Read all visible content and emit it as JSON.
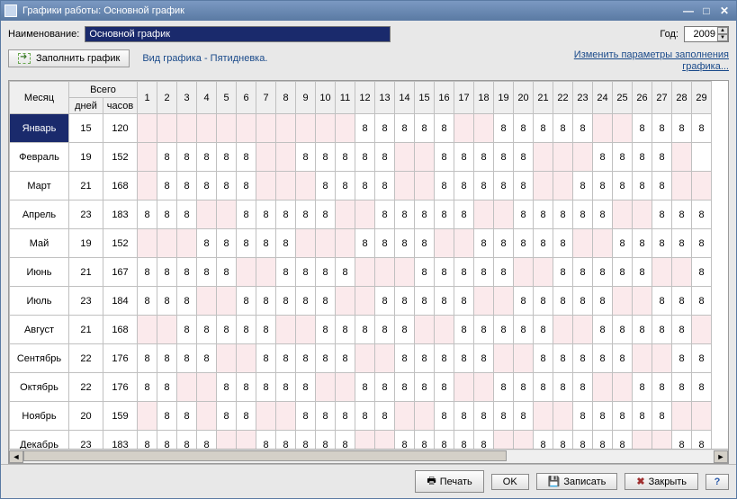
{
  "window": {
    "title": "Графики работы: Основной график"
  },
  "toolbar": {
    "name_label": "Наименование:",
    "name_value": "Основной график",
    "year_label": "Год:",
    "year_value": "2009",
    "fill_button": "Заполнить график",
    "schedule_type": "Вид графика - Пятидневка.",
    "change_params_link": "Изменить параметры заполнения графика..."
  },
  "grid": {
    "headers": {
      "month": "Месяц",
      "total": "Всего",
      "days": "дней",
      "hours": "часов"
    },
    "day_numbers": [
      1,
      2,
      3,
      4,
      5,
      6,
      7,
      8,
      9,
      10,
      11,
      12,
      13,
      14,
      15,
      16,
      17,
      18,
      19,
      20,
      21,
      22,
      23,
      24,
      25,
      26,
      27,
      28,
      29
    ],
    "months": [
      {
        "name": "Январь",
        "days": 15,
        "hours": 120,
        "weekend": [
          1,
          2,
          3,
          4,
          5,
          6,
          7,
          8,
          9,
          10,
          11,
          17,
          18,
          24,
          25
        ],
        "cells": {
          "12": 8,
          "13": 8,
          "14": 8,
          "15": 8,
          "16": 8,
          "19": 8,
          "20": 8,
          "21": 8,
          "22": 8,
          "23": 8,
          "26": 8,
          "27": 8,
          "28": 8,
          "29": 8
        }
      },
      {
        "name": "Февраль",
        "days": 19,
        "hours": 152,
        "weekend": [
          1,
          7,
          8,
          14,
          15,
          21,
          22,
          23,
          28
        ],
        "cells": {
          "2": 8,
          "3": 8,
          "4": 8,
          "5": 8,
          "6": 8,
          "9": 8,
          "10": 8,
          "11": 8,
          "12": 8,
          "13": 8,
          "16": 8,
          "17": 8,
          "18": 8,
          "19": 8,
          "20": 8,
          "24": 8,
          "25": 8,
          "26": 8,
          "27": 8
        }
      },
      {
        "name": "Март",
        "days": 21,
        "hours": 168,
        "weekend": [
          1,
          7,
          8,
          9,
          14,
          15,
          21,
          22,
          28,
          29
        ],
        "cells": {
          "2": 8,
          "3": 8,
          "4": 8,
          "5": 8,
          "6": 8,
          "10": 8,
          "11": 8,
          "12": 8,
          "13": 8,
          "16": 8,
          "17": 8,
          "18": 8,
          "19": 8,
          "20": 8,
          "23": 8,
          "24": 8,
          "25": 8,
          "26": 8,
          "27": 8
        }
      },
      {
        "name": "Апрель",
        "days": 23,
        "hours": 183,
        "weekend": [
          4,
          5,
          11,
          12,
          18,
          19,
          25,
          26
        ],
        "cells": {
          "1": 8,
          "2": 8,
          "3": 8,
          "6": 8,
          "7": 8,
          "8": 8,
          "9": 8,
          "10": 8,
          "13": 8,
          "14": 8,
          "15": 8,
          "16": 8,
          "17": 8,
          "20": 8,
          "21": 8,
          "22": 8,
          "23": 8,
          "24": 8,
          "27": 8,
          "28": 8,
          "29": 8
        }
      },
      {
        "name": "Май",
        "days": 19,
        "hours": 152,
        "weekend": [
          1,
          2,
          3,
          9,
          10,
          11,
          16,
          17,
          23,
          24
        ],
        "cells": {
          "4": 8,
          "5": 8,
          "6": 8,
          "7": 8,
          "8": 8,
          "12": 8,
          "13": 8,
          "14": 8,
          "15": 8,
          "18": 8,
          "19": 8,
          "20": 8,
          "21": 8,
          "22": 8,
          "25": 8,
          "26": 8,
          "27": 8,
          "28": 8,
          "29": 8
        }
      },
      {
        "name": "Июнь",
        "days": 21,
        "hours": 167,
        "weekend": [
          6,
          7,
          12,
          13,
          14,
          20,
          21,
          27,
          28
        ],
        "cells": {
          "1": 8,
          "2": 8,
          "3": 8,
          "4": 8,
          "5": 8,
          "8": 8,
          "9": 8,
          "10": 8,
          "11": 8,
          "15": 8,
          "16": 8,
          "17": 8,
          "18": 8,
          "19": 8,
          "22": 8,
          "23": 8,
          "24": 8,
          "25": 8,
          "26": 8,
          "29": 8
        }
      },
      {
        "name": "Июль",
        "days": 23,
        "hours": 184,
        "weekend": [
          4,
          5,
          11,
          12,
          18,
          19,
          25,
          26
        ],
        "cells": {
          "1": 8,
          "2": 8,
          "3": 8,
          "6": 8,
          "7": 8,
          "8": 8,
          "9": 8,
          "10": 8,
          "13": 8,
          "14": 8,
          "15": 8,
          "16": 8,
          "17": 8,
          "20": 8,
          "21": 8,
          "22": 8,
          "23": 8,
          "24": 8,
          "27": 8,
          "28": 8,
          "29": 8
        }
      },
      {
        "name": "Август",
        "days": 21,
        "hours": 168,
        "weekend": [
          1,
          2,
          8,
          9,
          15,
          16,
          22,
          23,
          29
        ],
        "cells": {
          "3": 8,
          "4": 8,
          "5": 8,
          "6": 8,
          "7": 8,
          "10": 8,
          "11": 8,
          "12": 8,
          "13": 8,
          "14": 8,
          "17": 8,
          "18": 8,
          "19": 8,
          "20": 8,
          "21": 8,
          "24": 8,
          "25": 8,
          "26": 8,
          "27": 8,
          "28": 8
        }
      },
      {
        "name": "Сентябрь",
        "days": 22,
        "hours": 176,
        "weekend": [
          5,
          6,
          12,
          13,
          19,
          20,
          26,
          27
        ],
        "cells": {
          "1": 8,
          "2": 8,
          "3": 8,
          "4": 8,
          "7": 8,
          "8": 8,
          "9": 8,
          "10": 8,
          "11": 8,
          "14": 8,
          "15": 8,
          "16": 8,
          "17": 8,
          "18": 8,
          "21": 8,
          "22": 8,
          "23": 8,
          "24": 8,
          "25": 8,
          "28": 8,
          "29": 8
        }
      },
      {
        "name": "Октябрь",
        "days": 22,
        "hours": 176,
        "weekend": [
          3,
          4,
          10,
          11,
          17,
          18,
          24,
          25
        ],
        "cells": {
          "1": 8,
          "2": 8,
          "5": 8,
          "6": 8,
          "7": 8,
          "8": 8,
          "9": 8,
          "12": 8,
          "13": 8,
          "14": 8,
          "15": 8,
          "16": 8,
          "19": 8,
          "20": 8,
          "21": 8,
          "22": 8,
          "23": 8,
          "26": 8,
          "27": 8,
          "28": 8,
          "29": 8
        }
      },
      {
        "name": "Ноябрь",
        "days": 20,
        "hours": 159,
        "weekend": [
          1,
          4,
          7,
          8,
          14,
          15,
          21,
          22,
          28,
          29
        ],
        "cells": {
          "2": 8,
          "3": 8,
          "5": 8,
          "6": 8,
          "9": 8,
          "10": 8,
          "11": 8,
          "12": 8,
          "13": 8,
          "16": 8,
          "17": 8,
          "18": 8,
          "19": 8,
          "20": 8,
          "23": 8,
          "24": 8,
          "25": 8,
          "26": 8,
          "27": 8
        }
      },
      {
        "name": "Декабрь",
        "days": 23,
        "hours": 183,
        "weekend": [
          5,
          6,
          12,
          13,
          19,
          20,
          26,
          27
        ],
        "cells": {
          "1": 8,
          "2": 8,
          "3": 8,
          "4": 8,
          "7": 8,
          "8": 8,
          "9": 8,
          "10": 8,
          "11": 8,
          "14": 8,
          "15": 8,
          "16": 8,
          "17": 8,
          "18": 8,
          "21": 8,
          "22": 8,
          "23": 8,
          "24": 8,
          "25": 8,
          "28": 8,
          "29": 8
        }
      }
    ]
  },
  "footer": {
    "print": "Печать",
    "ok": "OK",
    "save": "Записать",
    "close": "Закрыть"
  }
}
